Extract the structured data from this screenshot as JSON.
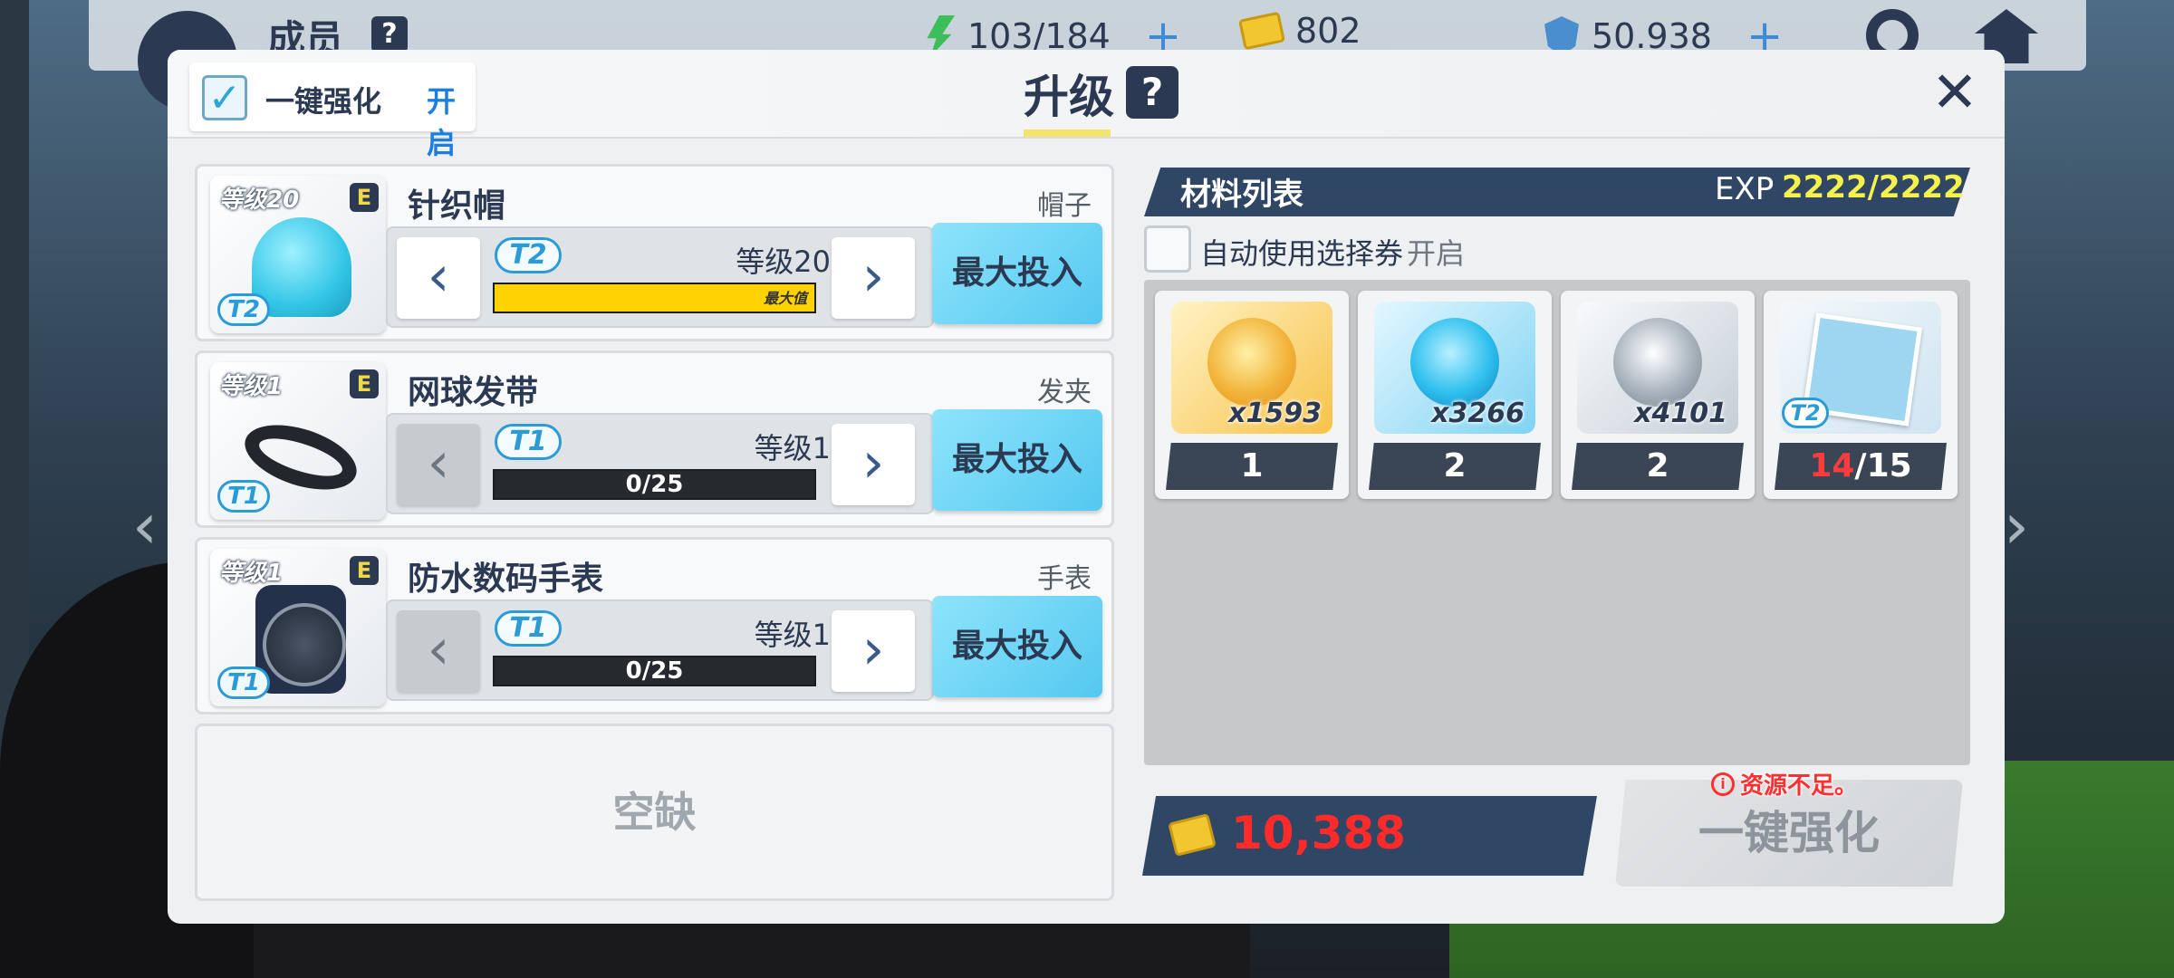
{
  "top": {
    "title": "成员",
    "help": "?",
    "stamina": "103/184",
    "tickets": "802",
    "gems": "50.938"
  },
  "panel": {
    "auto_label": "一键强化",
    "auto_state": "开启",
    "title": "升级",
    "help": "?",
    "close": "✕"
  },
  "items": [
    {
      "thumb_level": "等级20",
      "grade": "E",
      "tier": "T2",
      "name": "针织帽",
      "type": "帽子",
      "level": "等级20",
      "bar_text": "",
      "bar_max": "最大值",
      "progress": 1.0,
      "max_button": "最大投入"
    },
    {
      "thumb_level": "等级1",
      "grade": "E",
      "tier": "T1",
      "name": "网球发带",
      "type": "发夹",
      "level": "等级1",
      "bar_text": "0/25",
      "bar_max": "",
      "progress": 0.0,
      "max_button": "最大投入"
    },
    {
      "thumb_level": "等级1",
      "grade": "E",
      "tier": "T1",
      "name": "防水数码手表",
      "type": "手表",
      "level": "等级1",
      "bar_text": "0/25",
      "bar_max": "",
      "progress": 0.0,
      "max_button": "最大投入"
    }
  ],
  "empty_slot": "空缺",
  "materials": {
    "title": "材料列表",
    "exp_label": "EXP",
    "exp_value": "2222/2222",
    "auto_select_label": "自动使用选择券",
    "auto_select_state": "开启",
    "list": [
      {
        "kind": "gold",
        "qty": "x1593",
        "count": "1"
      },
      {
        "kind": "blue",
        "qty": "x3266",
        "count": "2"
      },
      {
        "kind": "silver",
        "qty": "x4101",
        "count": "2"
      },
      {
        "kind": "card",
        "tier": "T2",
        "count_have": "14",
        "count_total": "/15"
      }
    ]
  },
  "cost": "10,388",
  "enhance_button": "一键强化",
  "warning": "资源不足。",
  "colors": {
    "accent": "#2a9bd6",
    "warning": "#ff2b2b",
    "dark": "#2b3a52",
    "exp": "#f6f24b"
  }
}
